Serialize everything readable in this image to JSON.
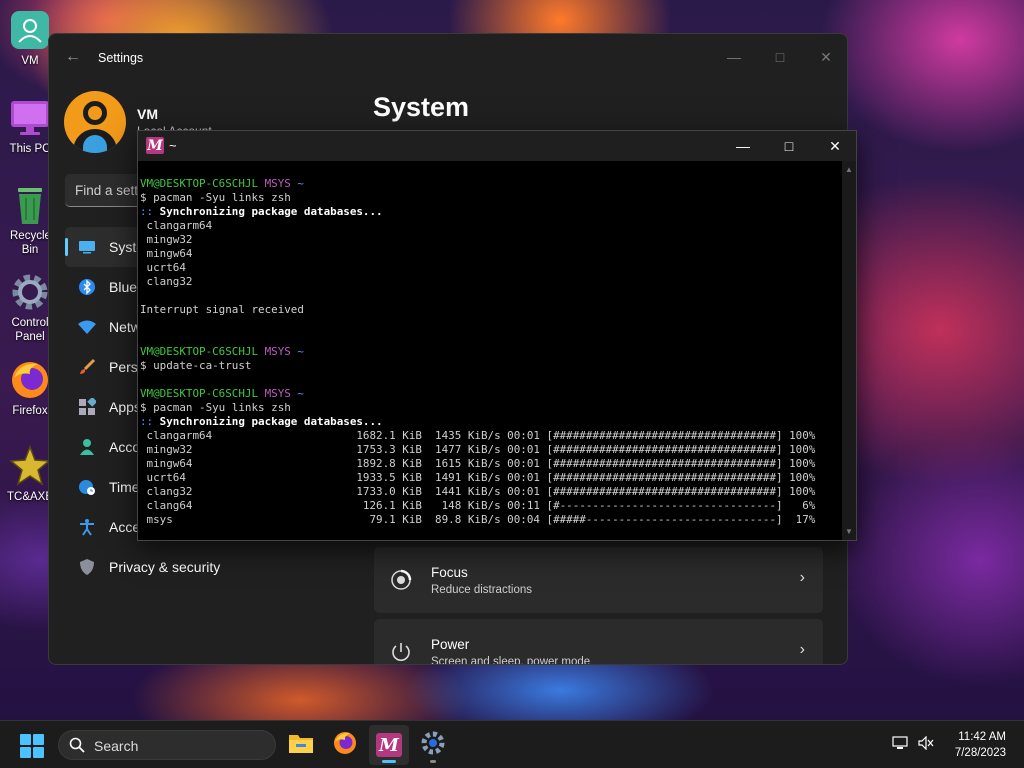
{
  "desktop": {
    "icons": [
      {
        "label": "VM",
        "icon": "user-folder-icon"
      },
      {
        "label": "This PC",
        "icon": "monitor-icon"
      },
      {
        "label": "Recycle Bin",
        "icon": "recycle-bin-icon"
      },
      {
        "label": "Control Panel",
        "icon": "gear-icon"
      },
      {
        "label": "Firefox",
        "icon": "firefox-icon"
      },
      {
        "label": "TC&AXE",
        "icon": "star-icon"
      }
    ]
  },
  "settings": {
    "app_title": "Settings",
    "user": {
      "name": "VM",
      "account_type": "Local Account"
    },
    "search_placeholder": "Find a setting",
    "page_title": "System",
    "nav": [
      {
        "label": "System",
        "icon": "monitor-icon",
        "active": true
      },
      {
        "label": "Bluetooth & devices",
        "icon": "bluetooth-icon"
      },
      {
        "label": "Network & internet",
        "icon": "wifi-icon"
      },
      {
        "label": "Personalization",
        "icon": "brush-icon"
      },
      {
        "label": "Apps",
        "icon": "apps-icon"
      },
      {
        "label": "Accounts",
        "icon": "person-icon"
      },
      {
        "label": "Time & language",
        "icon": "globe-clock-icon"
      },
      {
        "label": "Accessibility",
        "icon": "accessibility-icon"
      },
      {
        "label": "Privacy & security",
        "icon": "shield-icon"
      }
    ],
    "cards": [
      {
        "title": "Focus",
        "subtitle": "Reduce distractions",
        "icon": "focus-icon"
      },
      {
        "title": "Power",
        "subtitle": "Screen and sleep, power mode",
        "icon": "power-icon"
      }
    ]
  },
  "terminal": {
    "title": "~",
    "lines": [
      [
        {
          "t": "VM@DESKTOP-C6SCHJL ",
          "c": "green"
        },
        {
          "t": "MSYS ",
          "c": "purple"
        },
        {
          "t": "~",
          "c": "blue"
        }
      ],
      [
        {
          "t": "$ pacman -Syu links zsh"
        }
      ],
      [
        {
          "t": ":: ",
          "c": "blue"
        },
        {
          "t": "Synchronizing package databases...",
          "c": "bold"
        }
      ],
      [
        {
          "t": " clangarm64"
        }
      ],
      [
        {
          "t": " mingw32"
        }
      ],
      [
        {
          "t": " mingw64"
        }
      ],
      [
        {
          "t": " ucrt64"
        }
      ],
      [
        {
          "t": " clang32"
        }
      ],
      [
        {
          "t": ""
        }
      ],
      [
        {
          "t": "Interrupt signal received"
        }
      ],
      [
        {
          "t": ""
        }
      ],
      [
        {
          "t": ""
        }
      ],
      [
        {
          "t": "VM@DESKTOP-C6SCHJL ",
          "c": "green"
        },
        {
          "t": "MSYS ",
          "c": "purple"
        },
        {
          "t": "~",
          "c": "blue"
        }
      ],
      [
        {
          "t": "$ update-ca-trust"
        }
      ],
      [
        {
          "t": ""
        }
      ],
      [
        {
          "t": "VM@DESKTOP-C6SCHJL ",
          "c": "green"
        },
        {
          "t": "MSYS ",
          "c": "purple"
        },
        {
          "t": "~",
          "c": "blue"
        }
      ],
      [
        {
          "t": "$ pacman -Syu links zsh"
        }
      ],
      [
        {
          "t": ":: ",
          "c": "blue"
        },
        {
          "t": "Synchronizing package databases...",
          "c": "bold"
        }
      ],
      [
        {
          "t": " clangarm64                      1682.1 KiB  1435 KiB/s 00:01 [##################################] 100%"
        }
      ],
      [
        {
          "t": " mingw32                         1753.3 KiB  1477 KiB/s 00:01 [##################################] 100%"
        }
      ],
      [
        {
          "t": " mingw64                         1892.8 KiB  1615 KiB/s 00:01 [##################################] 100%"
        }
      ],
      [
        {
          "t": " ucrt64                          1933.5 KiB  1491 KiB/s 00:01 [##################################] 100%"
        }
      ],
      [
        {
          "t": " clang32                         1733.0 KiB  1441 KiB/s 00:01 [##################################] 100%"
        }
      ],
      [
        {
          "t": " clang64                          126.1 KiB   148 KiB/s 00:11 [#---------------------------------]   6%"
        }
      ],
      [
        {
          "t": " msys                              79.1 KiB  89.8 KiB/s 00:04 [#####-----------------------------]  17%"
        }
      ]
    ]
  },
  "taskbar": {
    "search_label": "Search",
    "apps": [
      {
        "name": "file-explorer",
        "icon": "folder-icon"
      },
      {
        "name": "firefox",
        "icon": "firefox-icon"
      },
      {
        "name": "msys2",
        "icon": "msys2-icon",
        "active": true
      },
      {
        "name": "settings",
        "icon": "gear-icon"
      }
    ],
    "time": "11:42 AM",
    "date": "7/28/2023"
  },
  "colors": {
    "accent": "#60cdff",
    "msys_brand": "#b33880",
    "term_green": "#3ec93e",
    "term_purple": "#c05ac0",
    "term_blue": "#5a8cff"
  }
}
